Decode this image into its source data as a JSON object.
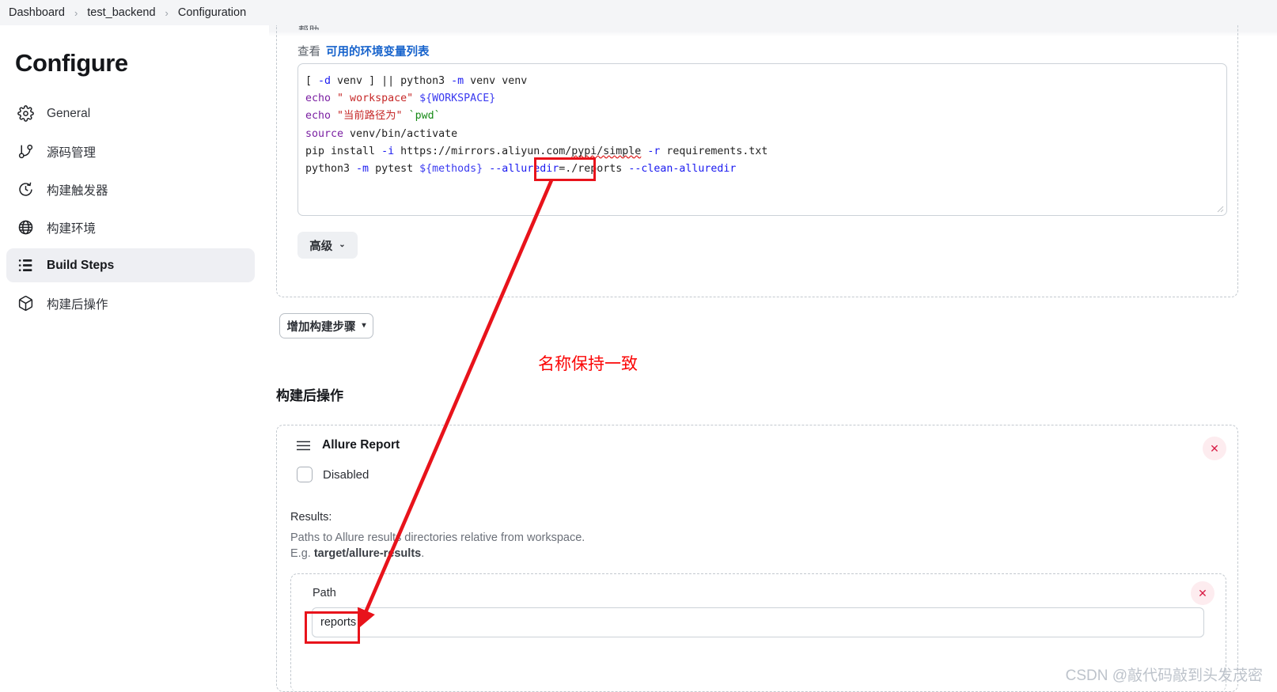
{
  "breadcrumb": {
    "items": [
      "Dashboard",
      "test_backend",
      "Configuration"
    ],
    "separator": "›"
  },
  "sidebar": {
    "title": "Configure",
    "items": [
      {
        "label": "General",
        "icon": "gear-icon",
        "active": false
      },
      {
        "label": "源码管理",
        "icon": "git-branch-icon",
        "active": false
      },
      {
        "label": "构建触发器",
        "icon": "clock-icon",
        "active": false
      },
      {
        "label": "构建环境",
        "icon": "globe-icon",
        "active": false
      },
      {
        "label": "Build Steps",
        "icon": "list-icon",
        "active": true
      },
      {
        "label": "构建后操作",
        "icon": "package-icon",
        "active": false
      }
    ]
  },
  "build_step": {
    "cut_label": "帮助",
    "env_prefix": "查看",
    "env_link": "可用的环境变量列表",
    "code_lines": [
      [
        {
          "t": "[ ",
          "c": "pln"
        },
        {
          "t": "-d",
          "c": "flag"
        },
        {
          "t": " venv ] || python3 ",
          "c": "pln"
        },
        {
          "t": "-m",
          "c": "flag"
        },
        {
          "t": " venv venv",
          "c": "pln"
        }
      ],
      [
        {
          "t": "echo",
          "c": "kw"
        },
        {
          "t": " ",
          "c": "pln"
        },
        {
          "t": "\" workspace\"",
          "c": "str"
        },
        {
          "t": " ",
          "c": "pln"
        },
        {
          "t": "${WORKSPACE}",
          "c": "var"
        }
      ],
      [
        {
          "t": "echo",
          "c": "kw"
        },
        {
          "t": " ",
          "c": "pln"
        },
        {
          "t": "\"当前路径为\"",
          "c": "str"
        },
        {
          "t": " ",
          "c": "pln"
        },
        {
          "t": "`pwd`",
          "c": "cmd"
        }
      ],
      [
        {
          "t": "source",
          "c": "kw"
        },
        {
          "t": " venv/bin/activate",
          "c": "pln"
        }
      ],
      [
        {
          "t": "pip install ",
          "c": "pln"
        },
        {
          "t": "-i",
          "c": "flag"
        },
        {
          "t": " https://mirrors.aliyun.com/",
          "c": "pln"
        },
        {
          "t": "pypi/simple",
          "c": "pln-spell"
        },
        {
          "t": " ",
          "c": "pln"
        },
        {
          "t": "-r",
          "c": "flag"
        },
        {
          "t": " requirements.txt",
          "c": "pln"
        }
      ],
      [
        {
          "t": "python3 ",
          "c": "pln"
        },
        {
          "t": "-m",
          "c": "flag"
        },
        {
          "t": " pytest ",
          "c": "pln"
        },
        {
          "t": "${methods}",
          "c": "var"
        },
        {
          "t": " ",
          "c": "pln"
        },
        {
          "t": "--alluredir",
          "c": "flag"
        },
        {
          "t": "=./reports ",
          "c": "pln"
        },
        {
          "t": "--clean-alluredir",
          "c": "flag"
        }
      ]
    ],
    "advanced_button": "高级",
    "advanced_caret": "⌄",
    "add_step_button": "增加构建步骤",
    "add_step_caret": "▾"
  },
  "post_build": {
    "heading": "构建后操作",
    "allure": {
      "title": "Allure Report",
      "disabled_label": "Disabled",
      "disabled_checked": false,
      "results_label": "Results:",
      "results_desc": "Paths to Allure results directories relative from workspace.",
      "results_eg_prefix": "E.g. ",
      "results_eg_value": "target/allure-results",
      "results_eg_suffix": ".",
      "path_label": "Path",
      "path_value": "reports",
      "path_placeholder": "",
      "close_label": "✕"
    }
  },
  "annotations": {
    "note_text": "名称保持一致",
    "note_color": "#fb0606",
    "box_color": "#e8131b"
  },
  "watermark": "CSDN @敲代码敲到头发茂密"
}
